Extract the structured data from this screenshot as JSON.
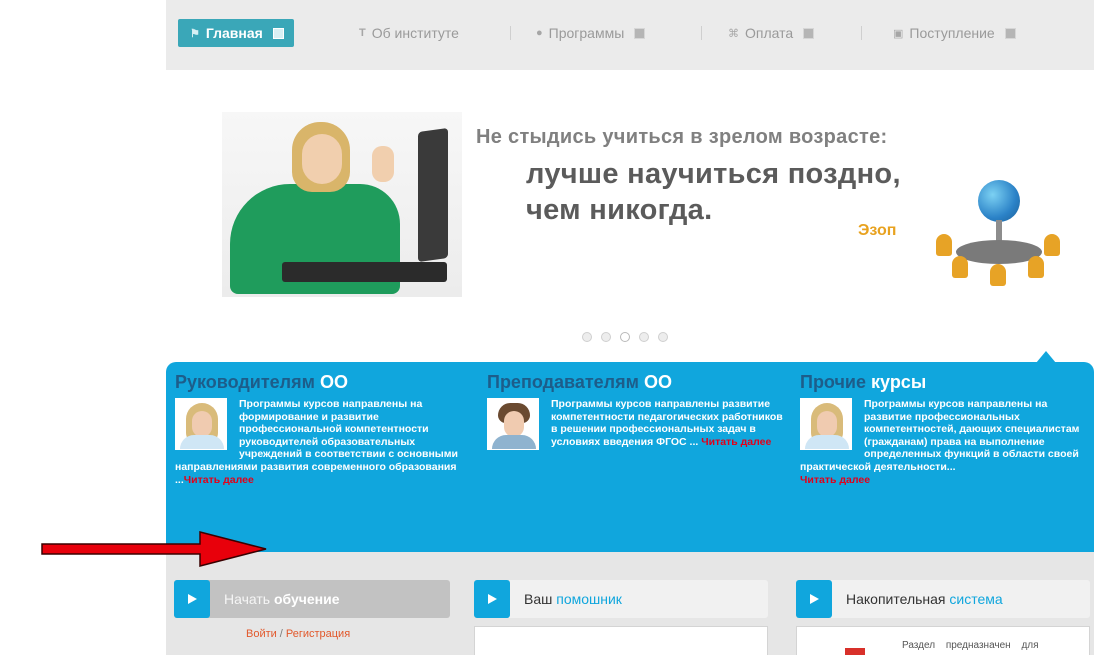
{
  "nav": {
    "items": [
      {
        "label": "Главная",
        "icon": "home-icon",
        "active": true
      },
      {
        "label": "Об институте",
        "icon": "text-icon",
        "active": false
      },
      {
        "label": "Программы",
        "icon": "pin-icon",
        "active": false
      },
      {
        "label": "Оплата",
        "icon": "coin-icon",
        "active": false
      },
      {
        "label": "Поступление",
        "icon": "document-icon",
        "active": false
      }
    ]
  },
  "banner": {
    "quote_line1": "Не стыдись учиться в зрелом возрасте:",
    "quote_line2": "лучше научиться поздно,",
    "quote_line3": "чем никогда.",
    "author": "Эзоп",
    "slide_count": 5,
    "active_slide": 3
  },
  "sections": [
    {
      "title_part1": "Руководителям",
      "title_part2": "ОО",
      "text": "Программы курсов направлены на формирование и развитие профессиональной компетентности руководителей образовательных учреждений в соответствии с основными направлениями развития современного образования ...",
      "more": "Читать далее"
    },
    {
      "title_part1": "Преподавателям",
      "title_part2": "ОО",
      "text": "Программы курсов направлены развитие компетентности педагогических работников в решении профессиональных задач в условиях введения ФГОС ... ",
      "more": "Читать далее"
    },
    {
      "title_part1": "Прочие",
      "title_part2": "курсы",
      "text": "Программы курсов направлены на развитие профессиональных компетентностей, дающих специалистам (гражданам) права на выполнение определенных функций в области своей практической деятельности...",
      "more": "Читать далее"
    }
  ],
  "panels": {
    "start": {
      "part1": "Начать",
      "part2": "обучение"
    },
    "helper": {
      "part1": "Ваш",
      "part2": "помошник"
    },
    "accum": {
      "part1": "Накопительная",
      "part2": "система"
    }
  },
  "login": {
    "login": "Войти",
    "separator": "/",
    "register": "Регистрация"
  },
  "accum_text": "Раздел предназначен для",
  "colors": {
    "accent": "#10a6dd",
    "nav_active": "#3aa7b8",
    "link_red": "#e2001a",
    "arrow_red": "#e8000b",
    "author": "#e8a21f"
  }
}
